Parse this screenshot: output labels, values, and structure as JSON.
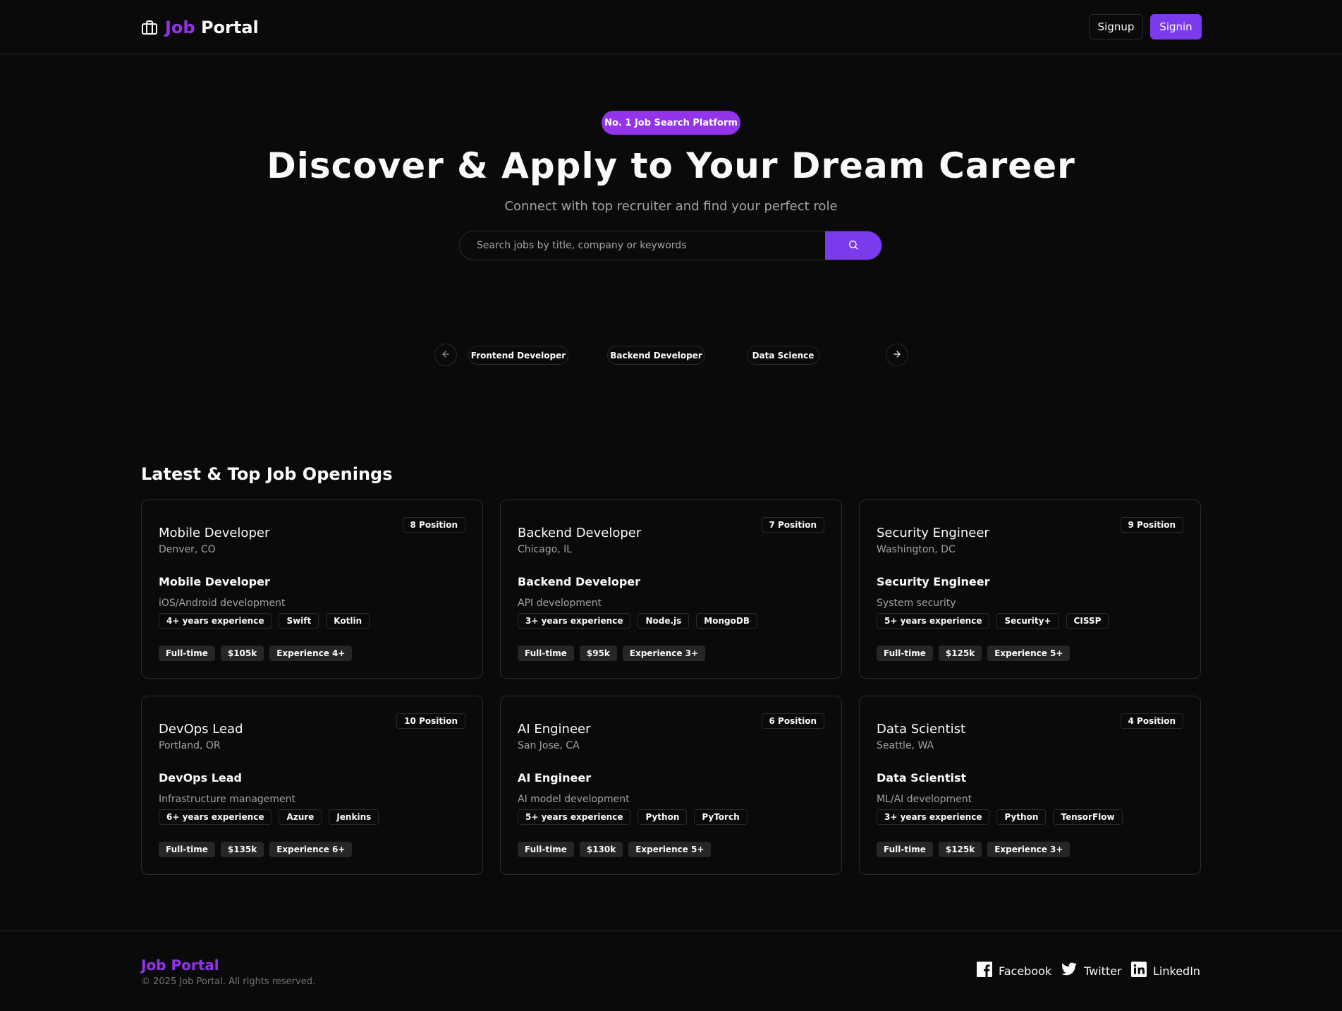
{
  "header": {
    "logo_icon": "briefcase-icon",
    "logo_part1": "Job",
    "logo_part2": "Portal",
    "signup_label": "Signup",
    "signin_label": "Signin",
    "accent_color": "#9333ea"
  },
  "hero": {
    "badge": "No. 1 Job Search Platform",
    "title": "Discover & Apply to Your Dream Career",
    "subtitle": "Connect with top recruiter and find your perfect role",
    "search_placeholder": "Search jobs by title, company or keywords",
    "search_icon": "search-icon"
  },
  "categories": {
    "prev_icon": "arrow-left-icon",
    "next_icon": "arrow-right-icon",
    "items": [
      "Frontend Developer",
      "Backend Developer",
      "Data Science"
    ]
  },
  "jobs": {
    "section_title": "Latest & Top Job Openings",
    "cards": [
      {
        "title": "Mobile Developer",
        "location": "Denver, CO",
        "positions": "8 Position",
        "role": "Mobile Developer",
        "description": "iOS/Android development",
        "requirements": [
          "4+ years experience",
          "Swift",
          "Kotlin"
        ],
        "tags": [
          "Full-time",
          "$105k",
          "Experience 4+"
        ]
      },
      {
        "title": "Backend Developer",
        "location": "Chicago, IL",
        "positions": "7 Position",
        "role": "Backend Developer",
        "description": "API development",
        "requirements": [
          "3+ years experience",
          "Node.js",
          "MongoDB"
        ],
        "tags": [
          "Full-time",
          "$95k",
          "Experience 3+"
        ]
      },
      {
        "title": "Security Engineer",
        "location": "Washington, DC",
        "positions": "9 Position",
        "role": "Security Engineer",
        "description": "System security",
        "requirements": [
          "5+ years experience",
          "Security+",
          "CISSP"
        ],
        "tags": [
          "Full-time",
          "$125k",
          "Experience 5+"
        ]
      },
      {
        "title": "DevOps Lead",
        "location": "Portland, OR",
        "positions": "10 Position",
        "role": "DevOps Lead",
        "description": "Infrastructure management",
        "requirements": [
          "6+ years experience",
          "Azure",
          "Jenkins"
        ],
        "tags": [
          "Full-time",
          "$135k",
          "Experience 6+"
        ]
      },
      {
        "title": "AI Engineer",
        "location": "San Jose, CA",
        "positions": "6 Position",
        "role": "AI Engineer",
        "description": "AI model development",
        "requirements": [
          "5+ years experience",
          "Python",
          "PyTorch"
        ],
        "tags": [
          "Full-time",
          "$130k",
          "Experience 5+"
        ]
      },
      {
        "title": "Data Scientist",
        "location": "Seattle, WA",
        "positions": "4 Position",
        "role": "Data Scientist",
        "description": "ML/AI development",
        "requirements": [
          "3+ years experience",
          "Python",
          "TensorFlow"
        ],
        "tags": [
          "Full-time",
          "$125k",
          "Experience 3+"
        ]
      }
    ]
  },
  "footer": {
    "brand": "Job Portal",
    "copyright": "© 2025 Job Portal. All rights reserved.",
    "facebook": "Facebook",
    "twitter": "Twitter",
    "linkedin": "LinkedIn"
  }
}
